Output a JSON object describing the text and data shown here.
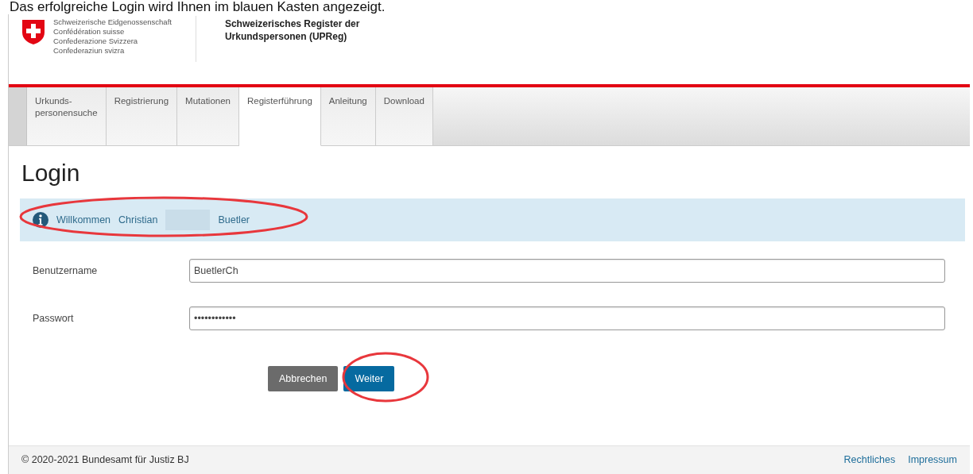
{
  "caption": "Das erfolgreiche Login wird Ihnen im blauen Kasten angezeigt.",
  "header": {
    "org_lines": [
      "Schweizerische Eidgenossenschaft",
      "Confédération suisse",
      "Confederazione Svizzera",
      "Confederaziun svizra"
    ],
    "title_lines": [
      "Schweizerisches Register der",
      "Urkundspersonen (UPReg)"
    ]
  },
  "tabs": [
    {
      "label": "Urkunds-\npersonensuche",
      "selected": false
    },
    {
      "label": "Registrierung",
      "selected": false
    },
    {
      "label": "Mutationen",
      "selected": false
    },
    {
      "label": "Registerführung",
      "selected": true
    },
    {
      "label": "Anleitung",
      "selected": false
    },
    {
      "label": "Download",
      "selected": false
    }
  ],
  "page_title": "Login",
  "alert": {
    "greeting": "Willkommen",
    "first_name": "Christian",
    "last_name": "Buetler"
  },
  "fields": [
    {
      "label": "Benutzername",
      "value": "BuetlerCh"
    },
    {
      "label": "Passwort",
      "value": "••••••••••••"
    }
  ],
  "buttons": [
    {
      "label": "Abbrechen",
      "kind": "secondary"
    },
    {
      "label": "Weiter",
      "kind": "primary"
    }
  ],
  "footer": {
    "copyright": "© 2020-2021 Bundesamt für Justiz BJ",
    "links": [
      "Rechtliches",
      "Impressum"
    ]
  }
}
